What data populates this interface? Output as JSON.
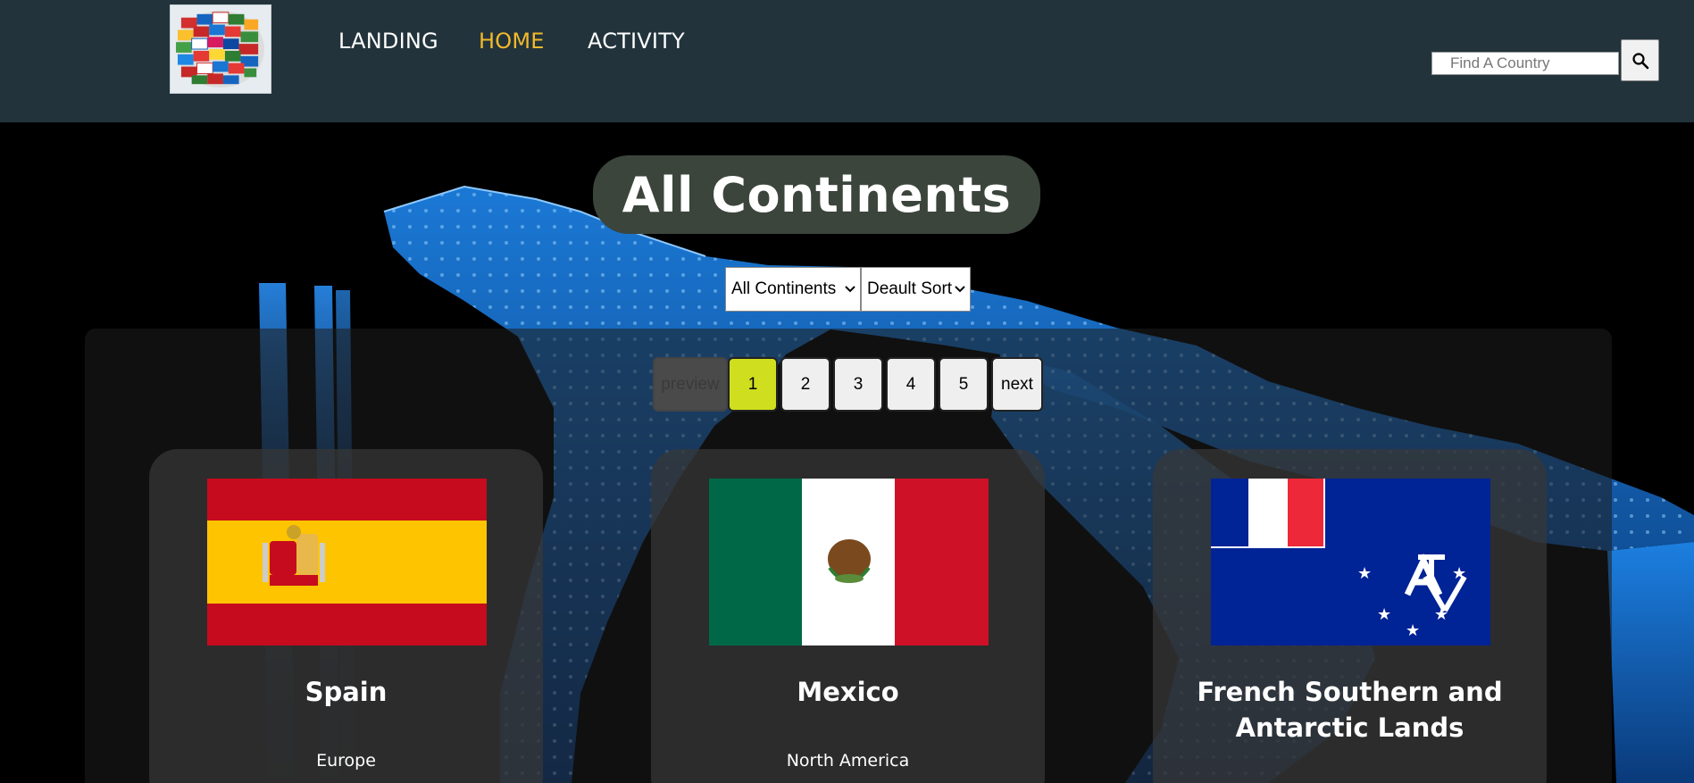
{
  "nav": {
    "logo_icon": "world-flags-logo",
    "links": [
      "LANDING",
      "HOME",
      "ACTIVITY"
    ],
    "active_color": "#f2b92b",
    "bg_color": "#22333b"
  },
  "search": {
    "placeholder": "Find A Country",
    "value": "",
    "icon": "search-icon"
  },
  "main": {
    "title": "All Continents",
    "filter_select": {
      "selected": "All Continents"
    },
    "sort_select": {
      "selected": "Deault Sort"
    }
  },
  "pagination": {
    "prev_label": "preview",
    "pages": [
      "1",
      "2",
      "3",
      "4",
      "5"
    ],
    "current_page": "1",
    "next_label": "next",
    "current_color": "#cfdf1f"
  },
  "cards": [
    {
      "name": "Spain",
      "continent": "Europe",
      "flag_icon": "spain-flag"
    },
    {
      "name": "Mexico",
      "continent": "North America",
      "flag_icon": "mexico-flag"
    },
    {
      "name": "French Southern and Antarctic Lands",
      "continent": "",
      "flag_icon": "french-southern-antarctic-lands-flag"
    }
  ]
}
